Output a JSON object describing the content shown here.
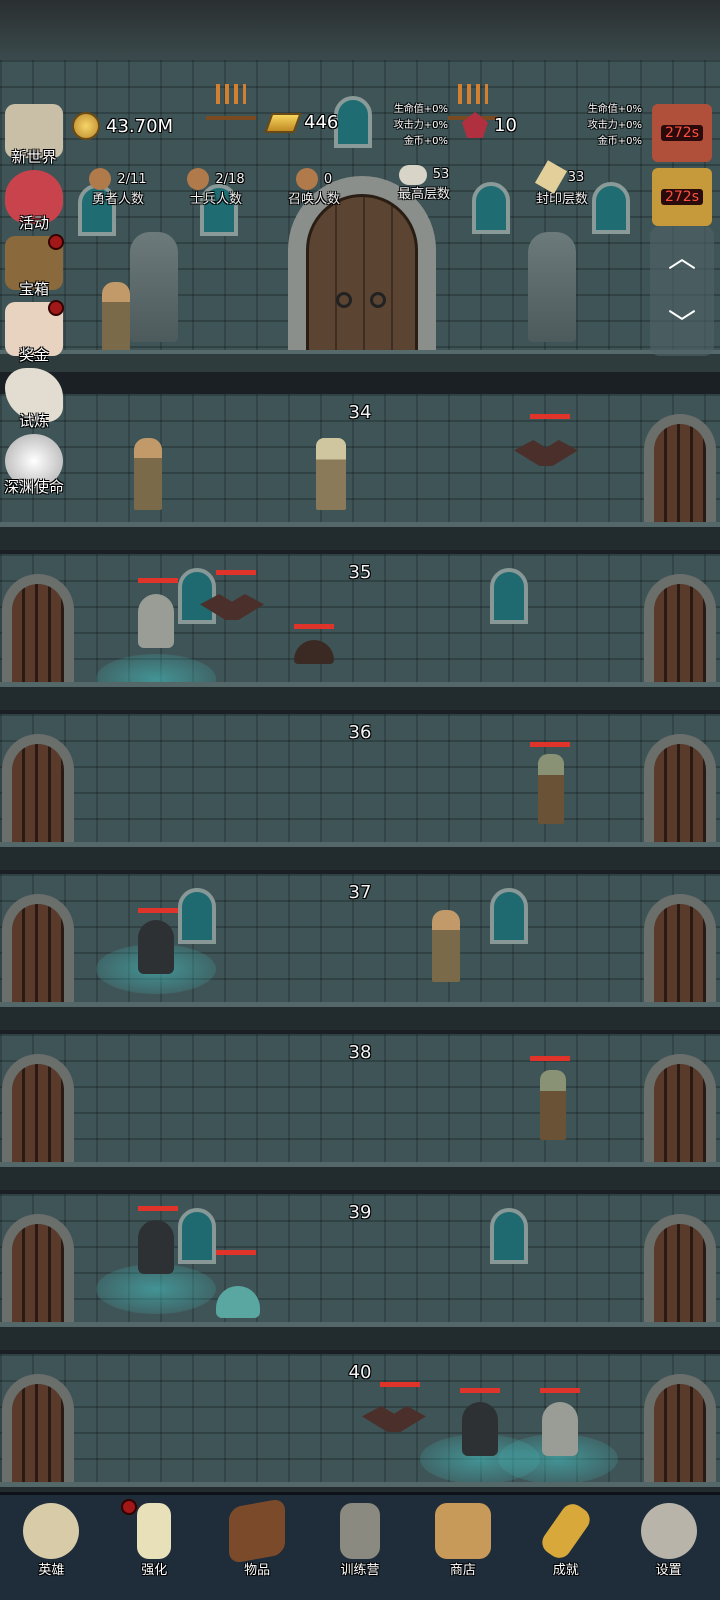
{
  "resources": {
    "gold": "43.70M",
    "gold_bars": "446",
    "gems": "10"
  },
  "bonuses_left": [
    "生命值+0%",
    "攻击力+0%",
    "金币+0%"
  ],
  "bonuses_right": [
    "生命值+0%",
    "攻击力+0%",
    "金币+0%"
  ],
  "stats": [
    {
      "value": "2/11",
      "label": "勇者人数"
    },
    {
      "value": "2/18",
      "label": "士兵人数"
    },
    {
      "value": "0",
      "label": "召唤人数"
    },
    {
      "value": "53",
      "label": "最高层数"
    },
    {
      "value": "33",
      "label": "封印层数"
    }
  ],
  "side_menu": [
    "新世界",
    "活动",
    "宝箱",
    "奖金",
    "试炼",
    "深渊使命"
  ],
  "timers": [
    "272s",
    "272s"
  ],
  "floors": [
    "34",
    "35",
    "36",
    "37",
    "38",
    "39",
    "40"
  ],
  "nav": [
    "英雄",
    "强化",
    "物品",
    "训练营",
    "商店",
    "成就",
    "设置"
  ],
  "colors": {
    "wall": "#3f5457",
    "health_bar": "#e0332a",
    "nav_bg": "#1f2c3a",
    "badge": "#a01818"
  }
}
